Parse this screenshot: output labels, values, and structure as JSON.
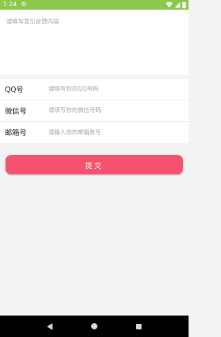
{
  "status_bar": {
    "time": "7:24",
    "gear_icon": "⚙",
    "color": "#8cc84b"
  },
  "feedback": {
    "placeholder": "请填写意见反馈内容"
  },
  "contact": {
    "qq": {
      "label": "QQ号",
      "placeholder": "请填写你的QQ号码"
    },
    "wechat": {
      "label": "微信号",
      "placeholder": "请填写你的微信号码"
    },
    "email": {
      "label": "邮箱号",
      "placeholder": "请输入你的邮箱账号"
    }
  },
  "submit": {
    "label": "提交",
    "color": "#f65270"
  },
  "nav_bar": {
    "icons": [
      "back-icon",
      "home-icon",
      "recent-apps-icon"
    ]
  }
}
